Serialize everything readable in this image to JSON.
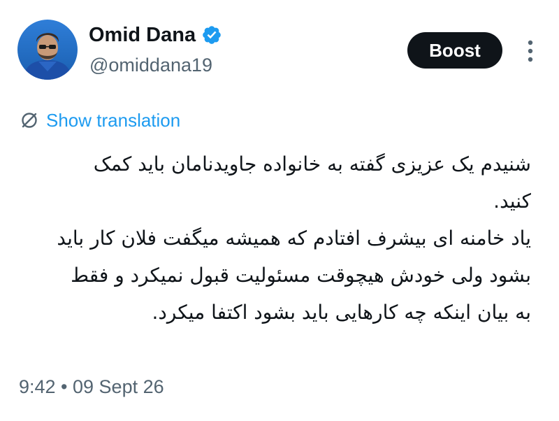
{
  "author": {
    "display_name": "Omid Dana",
    "handle": "@omiddana19",
    "verified": true,
    "verified_color": "#1d9bf0"
  },
  "actions": {
    "boost_label": "Boost",
    "more_icon": "more-vertical-icon"
  },
  "translation": {
    "label": "Show translation",
    "icon": "translate-icon",
    "color": "#1d9bf0"
  },
  "tweet": {
    "lines": [
      "شنیدم یک عزیزی گفته به خانواده جاویدنامان باید کمک",
      "کنید.",
      "یاد خامنه ای بیشرف افتادم که همیشه میگفت فلان کار باید",
      "بشود ولی خودش هیچوقت مسئولیت قبول نمیکرد و فقط",
      "به بیان اینکه چه کارهایی باید بشود اکتفا میکرد."
    ]
  },
  "timestamp": "9:42 • 09 Sept 26"
}
